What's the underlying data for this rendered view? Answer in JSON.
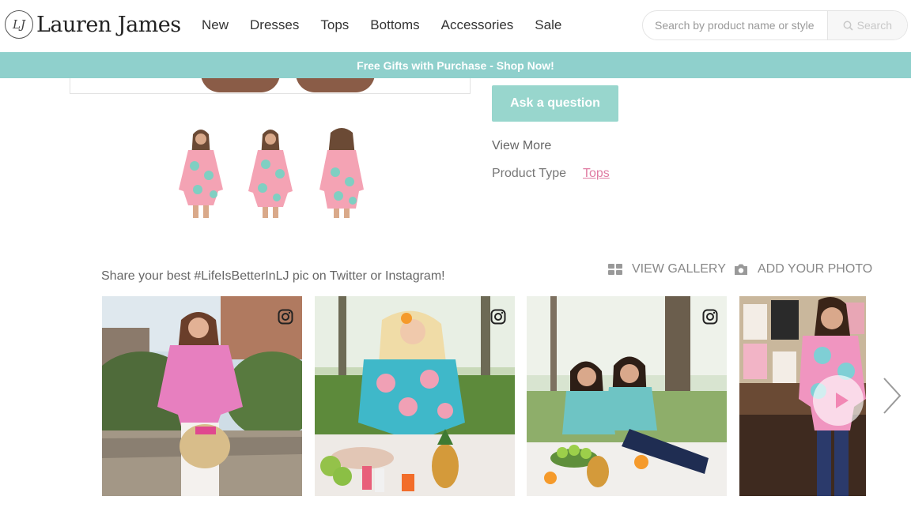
{
  "brand": {
    "logo_mark": "LJ",
    "name": "Lauren James"
  },
  "nav": [
    {
      "label": "New"
    },
    {
      "label": "Dresses"
    },
    {
      "label": "Tops"
    },
    {
      "label": "Bottoms"
    },
    {
      "label": "Accessories"
    },
    {
      "label": "Sale"
    }
  ],
  "search": {
    "placeholder": "Search by product name or style",
    "button_label": "Search"
  },
  "promo": {
    "text": "Free Gifts with Purchase - Shop Now!"
  },
  "product": {
    "ask_label": "Ask a question",
    "view_more": "View More",
    "type_label": "Product Type",
    "type_value": "Tops"
  },
  "gallery": {
    "share_text": "Share your best #LifeIsBetterInLJ pic on Twitter or Instagram!",
    "view_gallery": "VIEW GALLERY",
    "add_photo": "ADD YOUR PHOTO"
  },
  "colors": {
    "teal": "#8fd0cc",
    "button": "#98d6cd",
    "link_pink": "#e07ca3"
  },
  "icons": [
    "search-icon",
    "grid-icon",
    "camera-icon",
    "instagram-icon",
    "chevron-right-icon",
    "play-icon"
  ]
}
